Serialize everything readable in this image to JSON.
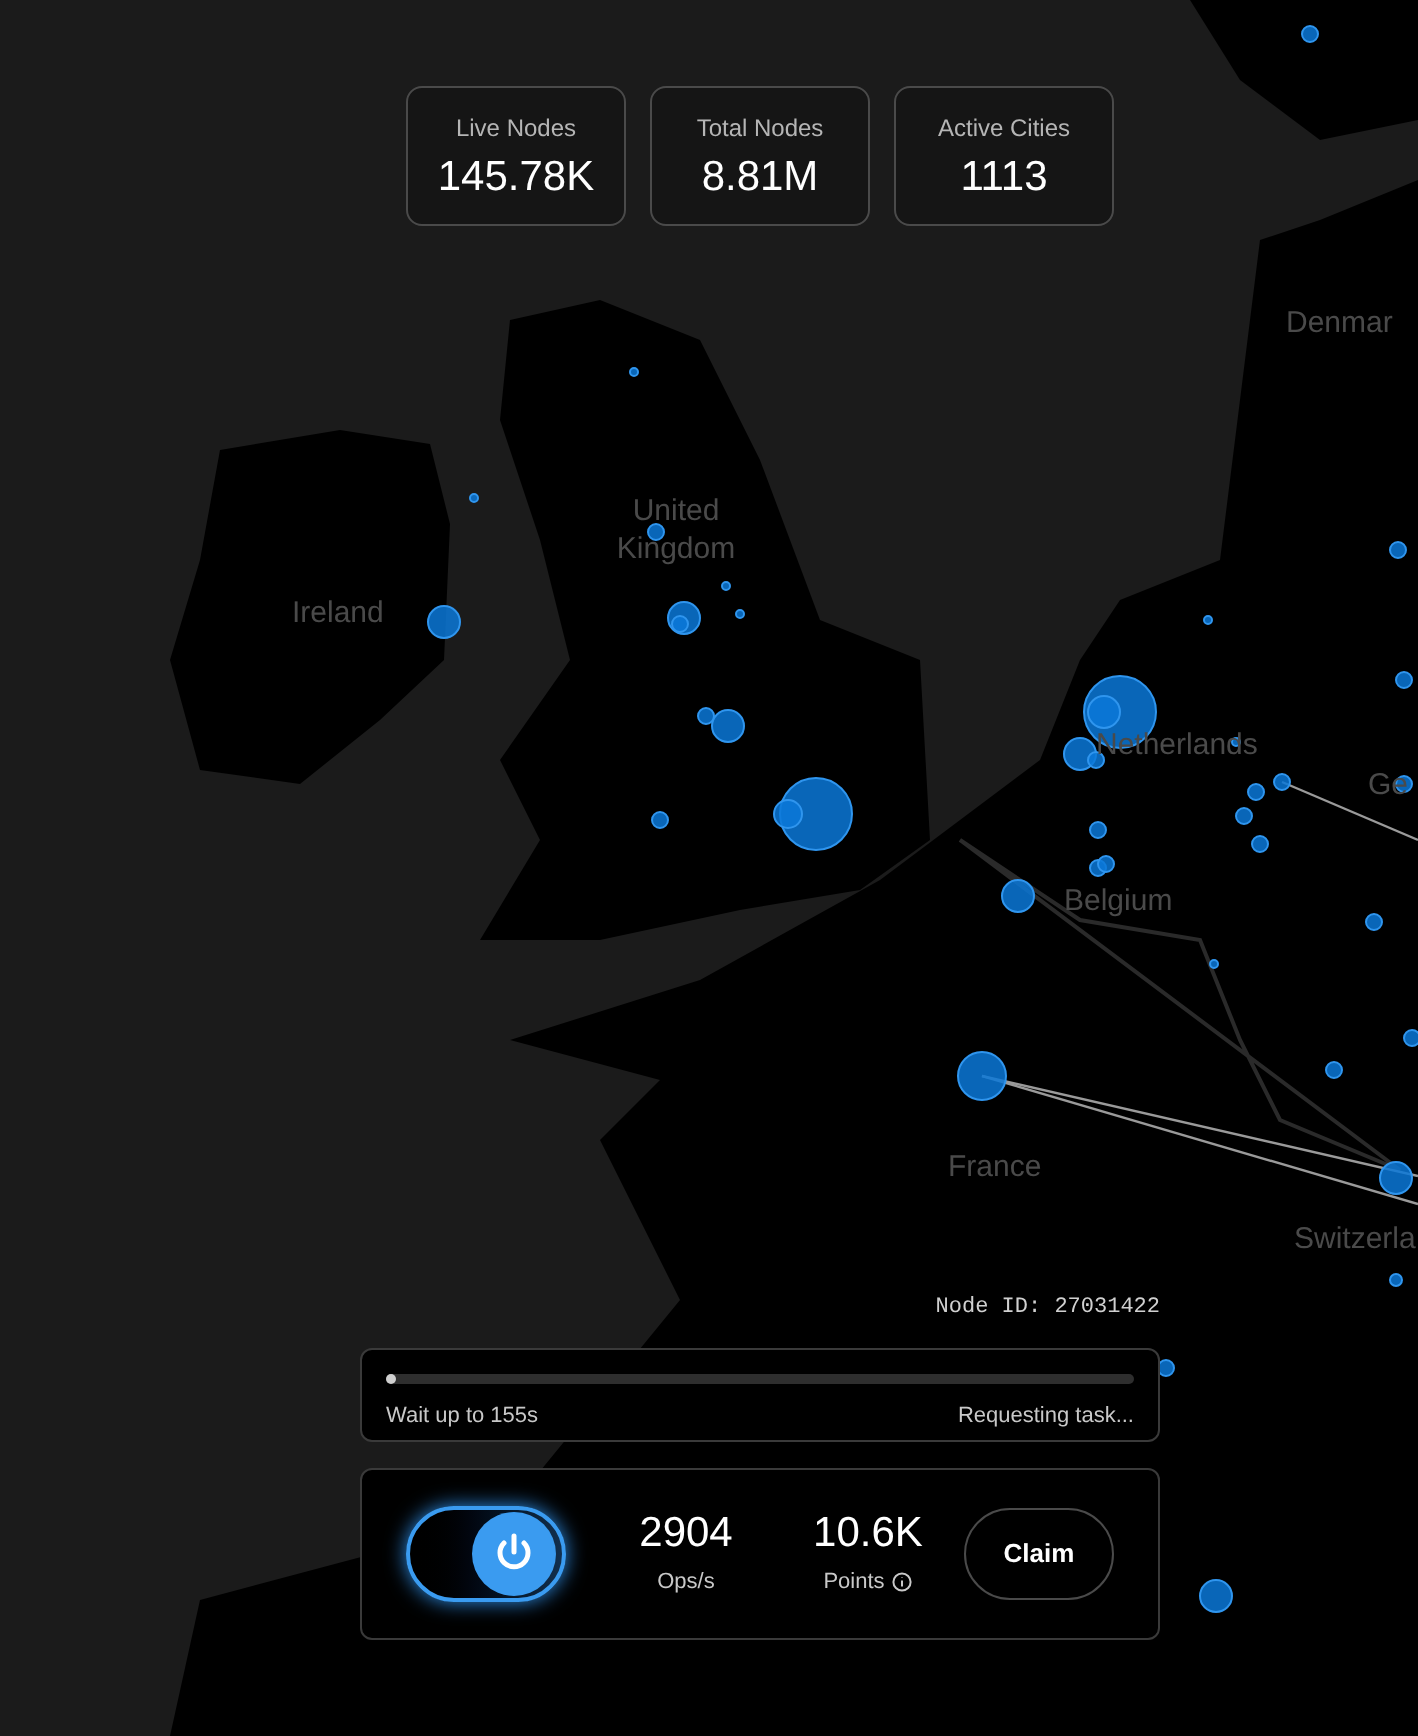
{
  "map": {
    "labels": [
      "Denmar",
      "United Kingdom",
      "Ireland",
      "Netherlands",
      "Ge",
      "Belgium",
      "France",
      "Switzerla"
    ]
  },
  "stats": [
    {
      "label": "Live Nodes",
      "value": "145.78K"
    },
    {
      "label": "Total Nodes",
      "value": "8.81M"
    },
    {
      "label": "Active Cities",
      "value": "1113"
    }
  ],
  "node_id": "Node ID: 27031422",
  "task": {
    "level": 0.01,
    "wait": "Wait up to 155s",
    "status": "Requesting task..."
  },
  "controls": {
    "power_on": true,
    "ops": {
      "value": "2904",
      "label": "Ops/s"
    },
    "points": {
      "value": "10.6K",
      "label": "Points"
    },
    "claim": "Claim"
  }
}
